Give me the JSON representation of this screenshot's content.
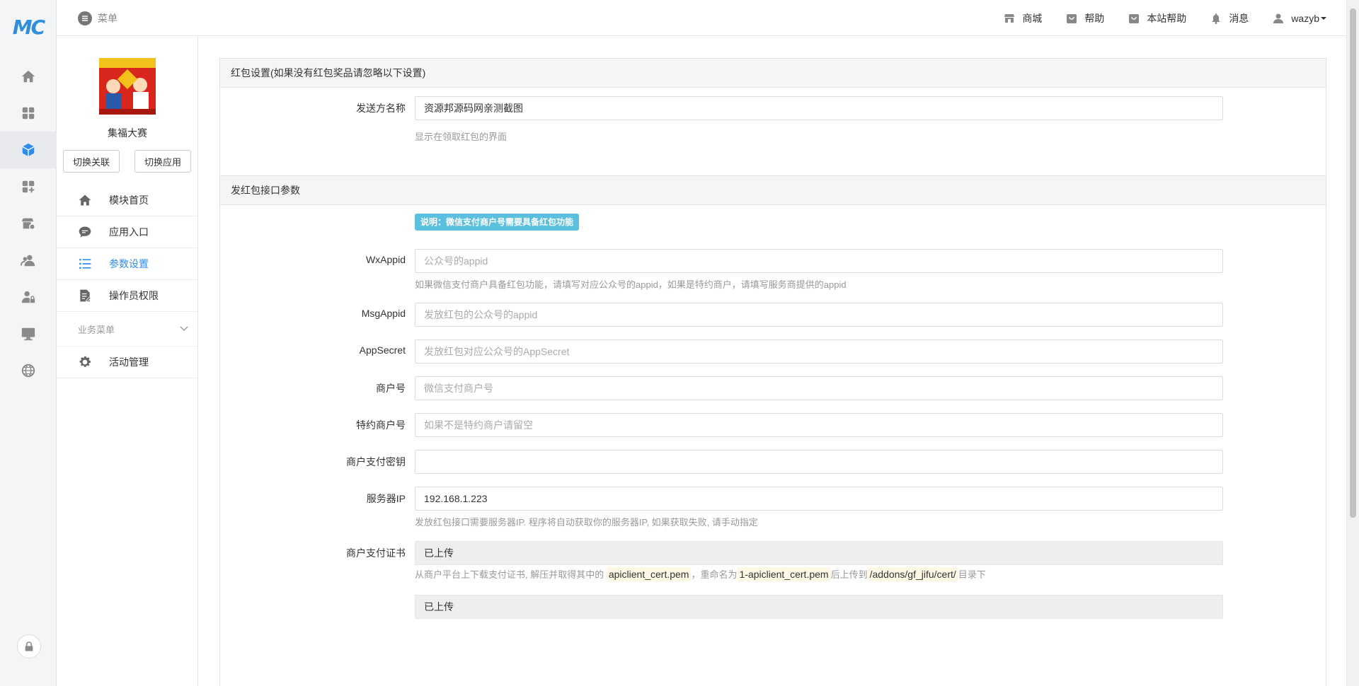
{
  "app": {
    "logo_text": "MC"
  },
  "rail": {
    "icons": [
      "home-icon",
      "apps-grid-icon",
      "cube-icon",
      "add-grid-icon",
      "store-settings-icon",
      "users-icon",
      "user-lock-icon",
      "monitor-icon",
      "globe-icon"
    ],
    "active_index": 2,
    "lock_icon": "lock-icon"
  },
  "topbar": {
    "menu_label": "菜单",
    "nav": [
      {
        "icon": "store-icon",
        "label": "商城"
      },
      {
        "icon": "bag-icon",
        "label": "帮助"
      },
      {
        "icon": "bag-icon",
        "label": "本站帮助"
      },
      {
        "icon": "bell-icon",
        "label": "消息"
      },
      {
        "icon": "user-icon",
        "label": "wazyb"
      }
    ]
  },
  "module": {
    "name": "集福大赛",
    "switch_link_label": "切换关联",
    "switch_app_label": "切换应用",
    "nav": [
      {
        "icon": "home-icon",
        "label": "模块首页"
      },
      {
        "icon": "chat-icon",
        "label": "应用入口"
      },
      {
        "icon": "list-settings-icon",
        "label": "参数设置",
        "active": true
      },
      {
        "icon": "document-edit-icon",
        "label": "操作员权限"
      }
    ],
    "business_menu_label": "业务菜单",
    "business_nav": [
      {
        "icon": "gear-icon",
        "label": "活动管理"
      }
    ]
  },
  "form": {
    "section1_title": "红包设置(如果没有红包奖品请忽略以下设置)",
    "sender_name_label": "发送方名称",
    "sender_name_value": "资源邦源码网亲测截图",
    "sender_name_help": "显示在领取红包的界面",
    "section2_title": "发红包接口参数",
    "notice": "说明：微信支付商户号需要具备红包功能",
    "wxappid_label": "WxAppid",
    "wxappid_placeholder": "公众号的appid",
    "wxappid_help": "如果微信支付商户具备红包功能，请填写对应公众号的appid，如果是特约商户，请填写服务商提供的appid",
    "msgappid_label": "MsgAppid",
    "msgappid_placeholder": "发放红包的公众号的appid",
    "appsecret_label": "AppSecret",
    "appsecret_placeholder": "发放红包对应公众号的AppSecret",
    "mchid_label": "商户号",
    "mchid_placeholder": "微信支付商户号",
    "sub_mchid_label": "特约商户号",
    "sub_mchid_placeholder": "如果不是特约商户请留空",
    "pay_key_label": "商户支付密钥",
    "pay_key_value": "",
    "server_ip_label": "服务器IP",
    "server_ip_value": "192.168.1.223",
    "server_ip_help": "发放红包接口需要服务器IP. 程序将自动获取你的服务器IP, 如果获取失败, 请手动指定",
    "cert_label": "商户支付证书",
    "cert_status": "已上传",
    "cert_help_1": "从商户平台上下载支付证书, 解压并取得其中的",
    "cert_file": "apiclient_cert.pem",
    "cert_help_2": "，重命名为",
    "cert_rename": "1-apiclient_cert.pem",
    "cert_help_3": "后上传到",
    "cert_path": "/addons/gf_jifu/cert/",
    "cert_help_4": "目录下",
    "key_cert_status": "已上传"
  }
}
